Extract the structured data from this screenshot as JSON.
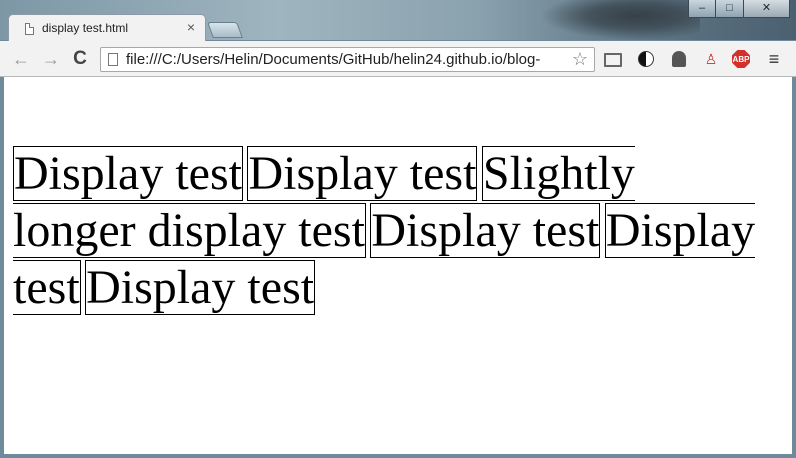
{
  "window": {
    "minimize_symbol": "‒",
    "maximize_symbol": "□",
    "close_symbol": "✕"
  },
  "tab": {
    "title": "display test.html",
    "close_symbol": "×"
  },
  "toolbar": {
    "back_symbol": "←",
    "forward_symbol": "→",
    "reload_symbol": "C",
    "url": "file:///C:/Users/Helin/Documents/GitHub/helin24.github.io/blog-",
    "star_symbol": "☆",
    "menu_symbol": "≡",
    "abp_label": "ABP"
  },
  "icons": [
    "page-icon",
    "back-icon",
    "forward-icon",
    "reload-icon",
    "star-icon",
    "cast-icon",
    "contrast-icon",
    "ghost-icon",
    "bug-icon",
    "adblock-icon",
    "menu-icon"
  ],
  "content": {
    "boxes": [
      "Display test",
      "Display test",
      "Slightly longer display test",
      "Display test",
      "Display test",
      "Display test"
    ]
  },
  "colors": {
    "page_background": "#ffffff",
    "toolbar": "#f2f2f2",
    "border": "#000000",
    "abp_red": "#d4302b"
  }
}
